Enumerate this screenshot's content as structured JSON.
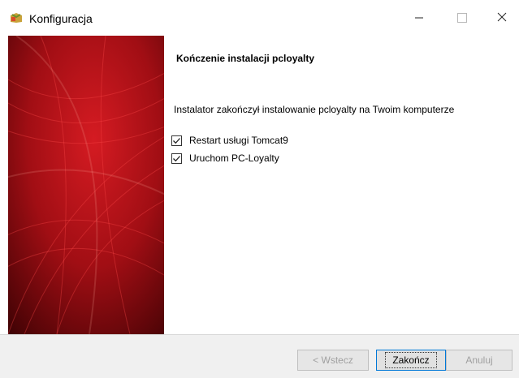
{
  "window": {
    "title": "Konfiguracja",
    "app_icon": "installer-app-icon",
    "controls": {
      "minimize": "minimize-icon",
      "maximize": "maximize-icon",
      "close": "close-icon"
    }
  },
  "page": {
    "heading": "Kończenie instalacji pcloyalty",
    "message": "Instalator zakończył instalowanie pcloyalty na Twoim komputerze",
    "options": [
      {
        "label": "Restart usługi Tomcat9",
        "checked": true
      },
      {
        "label": "Uruchom PC-Loyalty",
        "checked": true
      }
    ]
  },
  "footer": {
    "back_label": "< Wstecz",
    "finish_label": "Zakończ",
    "cancel_label": "Anuluj"
  },
  "colors": {
    "side_image_primary": "#b0131a",
    "side_image_dark": "#4a0305",
    "focus_border": "#0078d7",
    "footer_bg": "#f0f0f0"
  }
}
